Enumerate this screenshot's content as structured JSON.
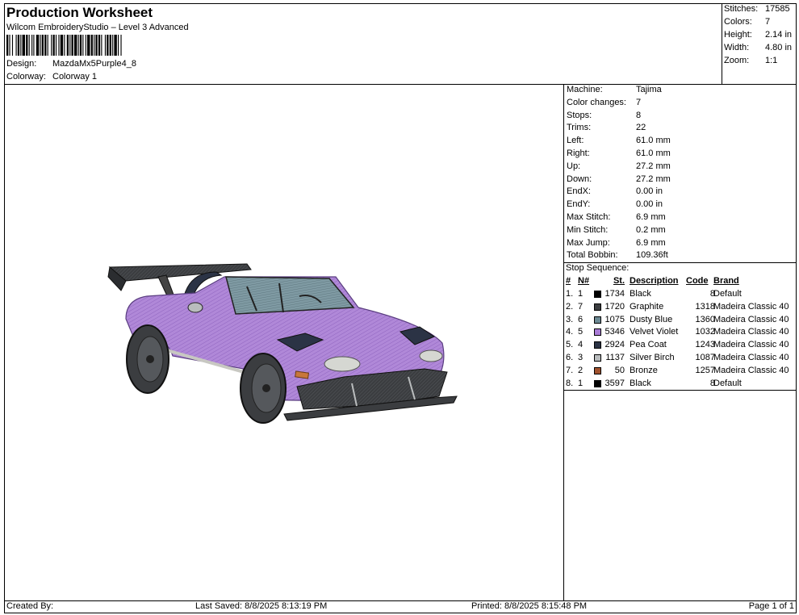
{
  "header": {
    "title": "Production Worksheet",
    "subtitle": "Wilcom EmbroideryStudio – Level 3 Advanced",
    "design_label": "Design:",
    "design_value": "MazdaMx5Purple4_8",
    "colorway_label": "Colorway:",
    "colorway_value": "Colorway 1"
  },
  "summary": [
    {
      "label": "Stitches:",
      "value": "17585"
    },
    {
      "label": "Colors:",
      "value": "7"
    },
    {
      "label": "Height:",
      "value": "2.14 in"
    },
    {
      "label": "Width:",
      "value": "4.80 in"
    },
    {
      "label": "Zoom:",
      "value": "1:1"
    }
  ],
  "machine_info": [
    {
      "label": "Machine:",
      "value": "Tajima"
    },
    {
      "label": "Color changes:",
      "value": "7"
    },
    {
      "label": "Stops:",
      "value": "8"
    },
    {
      "label": "Trims:",
      "value": "22"
    },
    {
      "label": "Left:",
      "value": "61.0 mm"
    },
    {
      "label": "Right:",
      "value": "61.0 mm"
    },
    {
      "label": "Up:",
      "value": "27.2 mm"
    },
    {
      "label": "Down:",
      "value": "27.2 mm"
    },
    {
      "label": "EndX:",
      "value": "0.00 in"
    },
    {
      "label": "EndY:",
      "value": "0.00 in"
    },
    {
      "label": "Max Stitch:",
      "value": "6.9 mm"
    },
    {
      "label": "Min Stitch:",
      "value": "0.2 mm"
    },
    {
      "label": "Max Jump:",
      "value": "6.9 mm"
    },
    {
      "label": "Total Bobbin:",
      "value": "109.36ft"
    }
  ],
  "stop_sequence": {
    "title": "Stop Sequence:",
    "headers": {
      "num": "#",
      "n": "N#",
      "st": "St.",
      "description": "Description",
      "code": "Code",
      "brand": "Brand"
    },
    "rows": [
      {
        "num": "1.",
        "n": "1",
        "color": "#000000",
        "st": "1734",
        "description": "Black",
        "code": "8",
        "brand": "Default"
      },
      {
        "num": "2.",
        "n": "7",
        "color": "#3b3d40",
        "st": "1720",
        "description": "Graphite",
        "code": "1318",
        "brand": "Madeira Classic 40"
      },
      {
        "num": "3.",
        "n": "6",
        "color": "#6d8a94",
        "st": "1075",
        "description": "Dusty Blue",
        "code": "1360",
        "brand": "Madeira Classic 40"
      },
      {
        "num": "4.",
        "n": "5",
        "color": "#a97bd6",
        "st": "5346",
        "description": "Velvet Violet",
        "code": "1032",
        "brand": "Madeira Classic 40"
      },
      {
        "num": "5.",
        "n": "4",
        "color": "#2b3345",
        "st": "2924",
        "description": "Pea Coat",
        "code": "1243",
        "brand": "Madeira Classic 40"
      },
      {
        "num": "6.",
        "n": "3",
        "color": "#b9bcbd",
        "st": "1137",
        "description": "Silver Birch",
        "code": "1087",
        "brand": "Madeira Classic 40"
      },
      {
        "num": "7.",
        "n": "2",
        "color": "#a0522d",
        "st": "50",
        "description": "Bronze",
        "code": "1257",
        "brand": "Madeira Classic 40"
      },
      {
        "num": "8.",
        "n": "1",
        "color": "#000000",
        "st": "3597",
        "description": "Black",
        "code": "8",
        "brand": "Default"
      }
    ]
  },
  "footer": {
    "created_by": "Created By:",
    "last_saved": "Last Saved: 8/8/2025 8:13:19 PM",
    "printed": "Printed: 8/8/2025 8:15:48 PM",
    "page": "Page 1 of 1"
  }
}
